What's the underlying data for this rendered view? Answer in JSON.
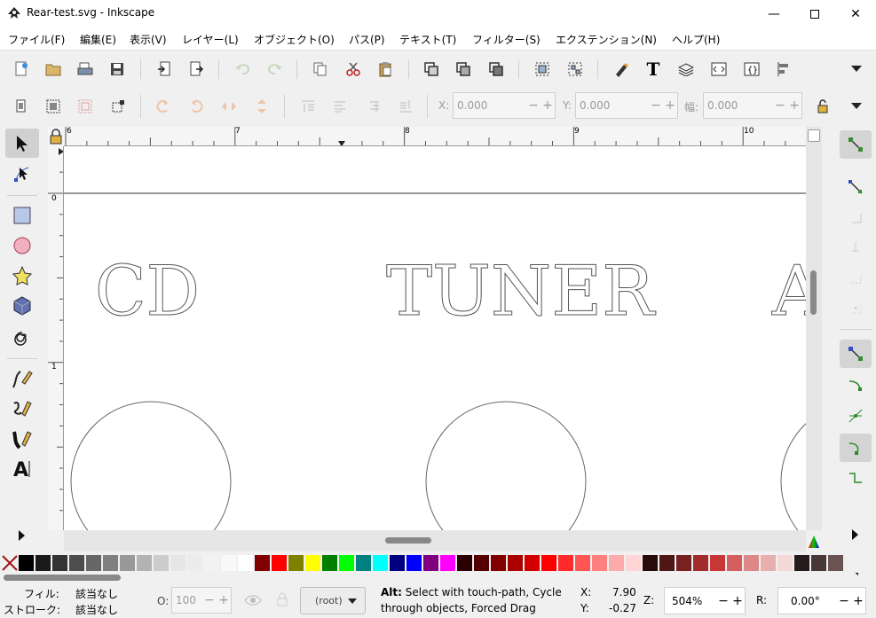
{
  "window": {
    "title": "Rear-test.svg - Inkscape"
  },
  "menu": [
    "ファイル(F)",
    "編集(E)",
    "表示(V)",
    "レイヤー(L)",
    "オブジェクト(O)",
    "パス(P)",
    "テキスト(T)",
    "フィルター(S)",
    "エクステンション(N)",
    "ヘルプ(H)"
  ],
  "coords_toolbar": {
    "x_label": "X:",
    "x_value": "0.000",
    "y_label": "Y:",
    "y_value": "0.000",
    "w_label": "幅:",
    "w_value": "0.000"
  },
  "ruler": {
    "h_ticks": [
      "6",
      "7",
      "8",
      "9",
      "10"
    ],
    "v_ticks": [
      "0",
      "1"
    ]
  },
  "canvas": {
    "texts": [
      "CD",
      "TUNER",
      "A"
    ]
  },
  "palette": [
    "#000000",
    "#1a1a1a",
    "#333333",
    "#4d4d4d",
    "#666666",
    "#808080",
    "#999999",
    "#b3b3b3",
    "#cccccc",
    "#e6e6e6",
    "#ececec",
    "#f2f2f2",
    "#f8f8f8",
    "#ffffff",
    "#800000",
    "#ff0000",
    "#808000",
    "#ffff00",
    "#008000",
    "#00ff00",
    "#008080",
    "#00ffff",
    "#000080",
    "#0000ff",
    "#800080",
    "#ff00ff",
    "#2b0000",
    "#550000",
    "#800000",
    "#aa0000",
    "#d40000",
    "#ff0000",
    "#ff2a2a",
    "#ff5555",
    "#ff8080",
    "#ffaaaa",
    "#ffd5d5",
    "#280b0b",
    "#501616",
    "#782121",
    "#a02c2c",
    "#c83737",
    "#d35f5f",
    "#de8787",
    "#e9afaf",
    "#f4d7d7",
    "#241c1c",
    "#483737",
    "#6c5353"
  ],
  "status": {
    "fill_label": "フィル:",
    "fill_value": "該当なし",
    "stroke_label": "ストローク:",
    "stroke_value": "該当なし",
    "opacity_label": "O:",
    "opacity_value": "100",
    "layer": "(root)",
    "message_bold": "Alt:",
    "message_line1": " Select with touch-path, Cycle",
    "message_line2": "through objects, Forced Drag",
    "x_label": "X:",
    "x_value": "7.90",
    "y_label": "Y:",
    "y_value": "-0.27",
    "zoom_label": "Z:",
    "zoom_value": "504%",
    "rot_label": "R:",
    "rot_value": "0.00°"
  }
}
